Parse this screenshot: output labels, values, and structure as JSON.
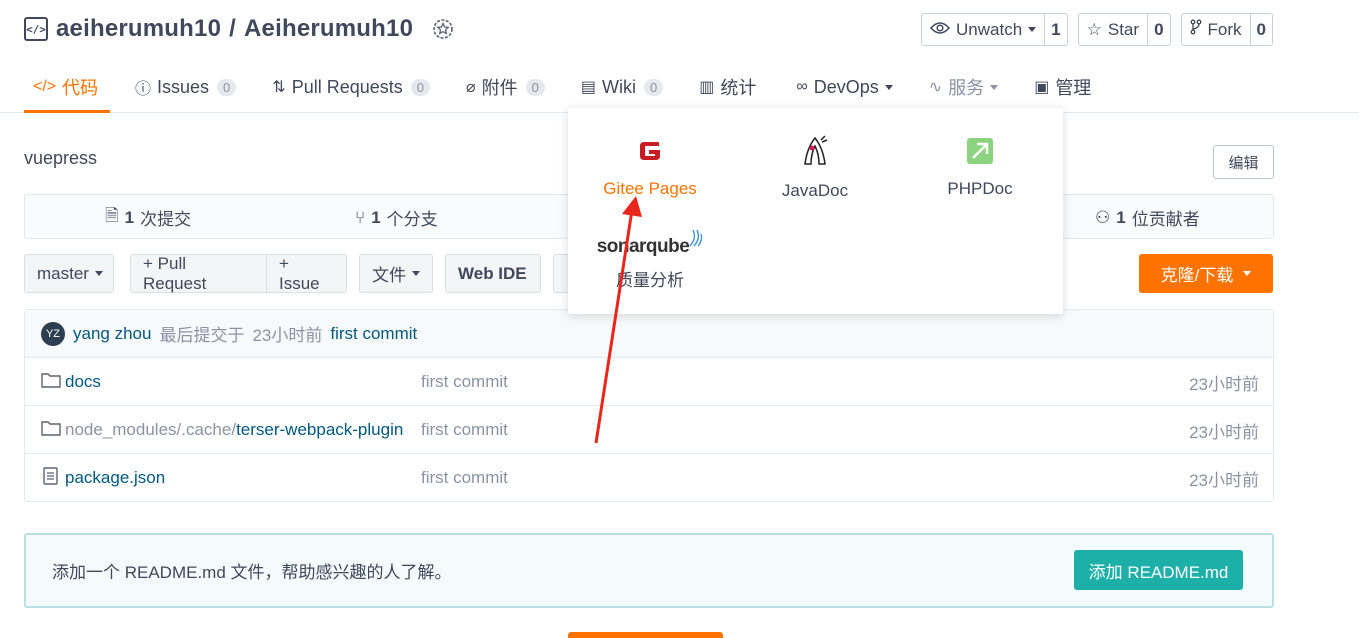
{
  "repo": {
    "owner": "aeiherumuh10",
    "separator": "/",
    "name": "Aeiherumuh10"
  },
  "actions": {
    "watch": {
      "label": "Unwatch",
      "count": "1"
    },
    "star": {
      "label": "Star",
      "count": "0"
    },
    "fork": {
      "label": "Fork",
      "count": "0"
    }
  },
  "nav": {
    "code": "代码",
    "issues": {
      "label": "Issues",
      "count": "0"
    },
    "pulls": {
      "label": "Pull Requests",
      "count": "0"
    },
    "attachments": {
      "label": "附件",
      "count": "0"
    },
    "wiki": {
      "label": "Wiki",
      "count": "0"
    },
    "stats": "统计",
    "devops": "DevOps",
    "services": "服务",
    "manage": "管理"
  },
  "description": "vuepress",
  "edit_label": "编辑",
  "stats": {
    "commits_count": "1",
    "commits_label": "次提交",
    "branches_count": "1",
    "branches_label": "个分支",
    "contributors_count": "1",
    "contributors_label": "位贡献者"
  },
  "toolbar": {
    "branch": "master",
    "pull_request": "+ Pull Request",
    "issue": "+ Issue",
    "files": "文件",
    "web_ide": "Web IDE",
    "clone": "克隆/下载"
  },
  "last_commit": {
    "avatar": "YZ",
    "author": "yang zhou",
    "prefix": "最后提交于",
    "time": "23小时前",
    "message": "first commit"
  },
  "files": [
    {
      "prefix": "",
      "name": "docs",
      "commit": "first commit",
      "time": "23小时前",
      "icon": "folder-icon"
    },
    {
      "prefix": "node_modules/.cache/",
      "name": "terser-webpack-plugin",
      "commit": "first commit",
      "time": "23小时前",
      "icon": "folder-icon"
    },
    {
      "prefix": "",
      "name": "package.json",
      "commit": "first commit",
      "time": "23小时前",
      "icon": "file-icon"
    }
  ],
  "readme": {
    "text": "添加一个 README.md 文件，帮助感兴趣的人了解。",
    "button": "添加 README.md"
  },
  "services_menu": [
    {
      "label": "Gitee Pages",
      "icon": "gitee-pages-icon"
    },
    {
      "label": "JavaDoc",
      "icon": "javadoc-icon"
    },
    {
      "label": "PHPDoc",
      "icon": "phpdoc-icon"
    },
    {
      "label": "质量分析",
      "icon": "sonarqube-icon"
    }
  ],
  "sonarqube_logo_text": "sonarqube",
  "colors": {
    "accent": "#fe7300",
    "teal": "#1cb0a8",
    "text": "#40485b",
    "muted": "#8c92a4",
    "link": "#005980",
    "annotation_arrow": "#e8261c"
  }
}
